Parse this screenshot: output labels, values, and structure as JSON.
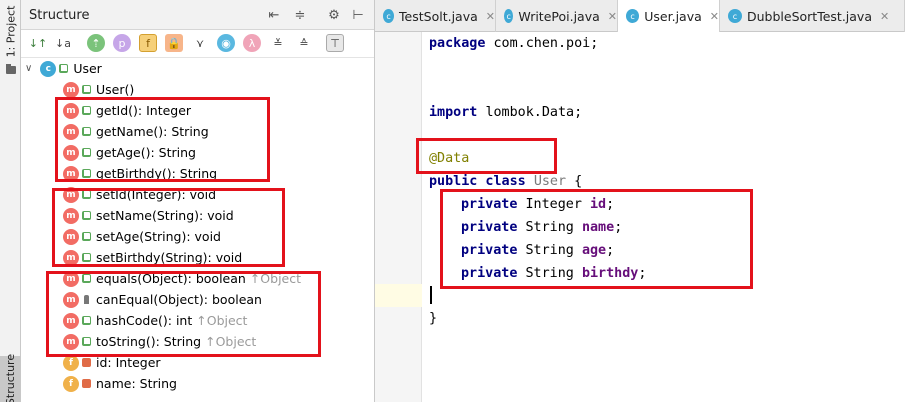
{
  "stripe": {
    "project_label": "1: Project",
    "structure_label": "Structure"
  },
  "structure": {
    "title": "Structure",
    "tree": {
      "class_name": "User",
      "items": [
        {
          "kind": "m",
          "text": "User()",
          "override": ""
        },
        {
          "kind": "m",
          "text": "getId(): Integer",
          "override": ""
        },
        {
          "kind": "m",
          "text": "getName(): String",
          "override": ""
        },
        {
          "kind": "m",
          "text": "getAge(): String",
          "override": ""
        },
        {
          "kind": "m",
          "text": "getBirthdy(): String",
          "override": ""
        },
        {
          "kind": "m",
          "text": "setId(Integer): void",
          "override": ""
        },
        {
          "kind": "m",
          "text": "setName(String): void",
          "override": ""
        },
        {
          "kind": "m",
          "text": "setAge(String): void",
          "override": ""
        },
        {
          "kind": "m",
          "text": "setBirthdy(String): void",
          "override": ""
        },
        {
          "kind": "m",
          "text": "equals(Object): boolean",
          "override": "↑Object"
        },
        {
          "kind": "m",
          "text": "canEqual(Object): boolean",
          "override": ""
        },
        {
          "kind": "m",
          "text": "hashCode(): int",
          "override": "↑Object"
        },
        {
          "kind": "m",
          "text": "toString(): String",
          "override": "↑Object"
        },
        {
          "kind": "f",
          "text": "id: Integer",
          "override": ""
        },
        {
          "kind": "f",
          "text": "name: String",
          "override": ""
        }
      ]
    }
  },
  "tabs": [
    {
      "label": "TestSolt.java",
      "active": false
    },
    {
      "label": "WritePoi.java",
      "active": false
    },
    {
      "label": "User.java",
      "active": true
    },
    {
      "label": "DubbleSortTest.java",
      "active": false
    }
  ],
  "code": {
    "package_kw": "package",
    "package_name": "com.chen.poi;",
    "import_kw": "import",
    "import_pkg": "lombok.",
    "import_cls": "Data;",
    "annotation": "@Data",
    "class_mods": "public class",
    "class_name": "User",
    "class_open": "{",
    "fields": [
      {
        "mod": "private",
        "type": "Integer",
        "name": "id"
      },
      {
        "mod": "private",
        "type": "String",
        "name": "name"
      },
      {
        "mod": "private",
        "type": "String",
        "name": "age"
      },
      {
        "mod": "private",
        "type": "String",
        "name": "birthdy"
      }
    ],
    "class_close": "}"
  },
  "colors": {
    "highlight_box": "#e3121b",
    "method_badge": "#f26c64",
    "class_badge": "#3fa9d6",
    "field_badge": "#f0b14a",
    "keyword": "#000080",
    "annotation": "#808000",
    "field_name": "#660e7a"
  }
}
